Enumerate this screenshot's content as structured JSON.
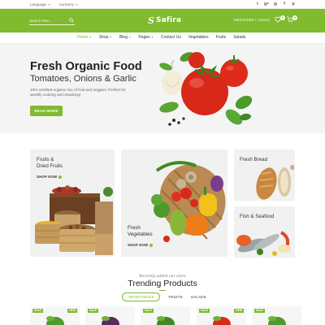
{
  "topbar": {
    "language": "Language",
    "currency": "Currency",
    "socials": [
      {
        "name": "twitter-icon",
        "glyph": "t"
      },
      {
        "name": "google-plus-icon",
        "glyph": "g+"
      },
      {
        "name": "dribbble-icon",
        "glyph": "◎"
      },
      {
        "name": "facebook-icon",
        "glyph": "f"
      },
      {
        "name": "pinterest-icon",
        "glyph": "p"
      }
    ]
  },
  "header": {
    "search_placeholder": "Search here...",
    "logo_text": "Safira",
    "logo_mark": "S",
    "account_link": "REGISTER / LOGIN",
    "wishlist_count": "0",
    "cart_count": "0",
    "brand_color": "#7fba2f"
  },
  "nav": {
    "items": [
      {
        "label": "Home",
        "has_dropdown": true,
        "active": true
      },
      {
        "label": "Shop",
        "has_dropdown": true,
        "active": false
      },
      {
        "label": "Blog",
        "has_dropdown": true,
        "active": false
      },
      {
        "label": "Pages",
        "has_dropdown": true,
        "active": false
      },
      {
        "label": "Contact Us",
        "has_dropdown": false,
        "active": false
      },
      {
        "label": "Vegetables",
        "has_dropdown": false,
        "active": false
      },
      {
        "label": "Fruits",
        "has_dropdown": false,
        "active": false
      },
      {
        "label": "Salads",
        "has_dropdown": false,
        "active": false
      }
    ]
  },
  "hero": {
    "title": "Fresh Organic Food",
    "subtitle": "Tomatoes, Onions & Garlic",
    "description": "10% certified-organic mix of fruit and veggies. Perfect for weekly cooking and snacking!",
    "button": "READ MORE"
  },
  "categories": {
    "fruits_title_line1": "Fruits &",
    "fruits_title_line2": "Dried Fruits",
    "fruits_cta": "SHOP NOW",
    "vegetables_title_line1": "Fresh",
    "vegetables_title_line2": "Vegetables",
    "vegetables_cta": "SHOP NOW",
    "bread_title": "Fresh Bread",
    "seafood_title": "Fish & Seafood"
  },
  "trending": {
    "eyebrow": "Recently added our store",
    "title": "Trending Products",
    "tabs": [
      {
        "label": "VEGETABLES",
        "active": true
      },
      {
        "label": "FRUITS",
        "active": false
      },
      {
        "label": "SALADS",
        "active": false
      }
    ],
    "products": [
      {
        "tag": "SALE",
        "tag2": "NEW"
      },
      {
        "tag": "SALE",
        "tag2": ""
      },
      {
        "tag": "SALE",
        "tag2": ""
      },
      {
        "tag": "SALE",
        "tag2": "NEW"
      },
      {
        "tag": "SALE",
        "tag2": ""
      }
    ]
  }
}
